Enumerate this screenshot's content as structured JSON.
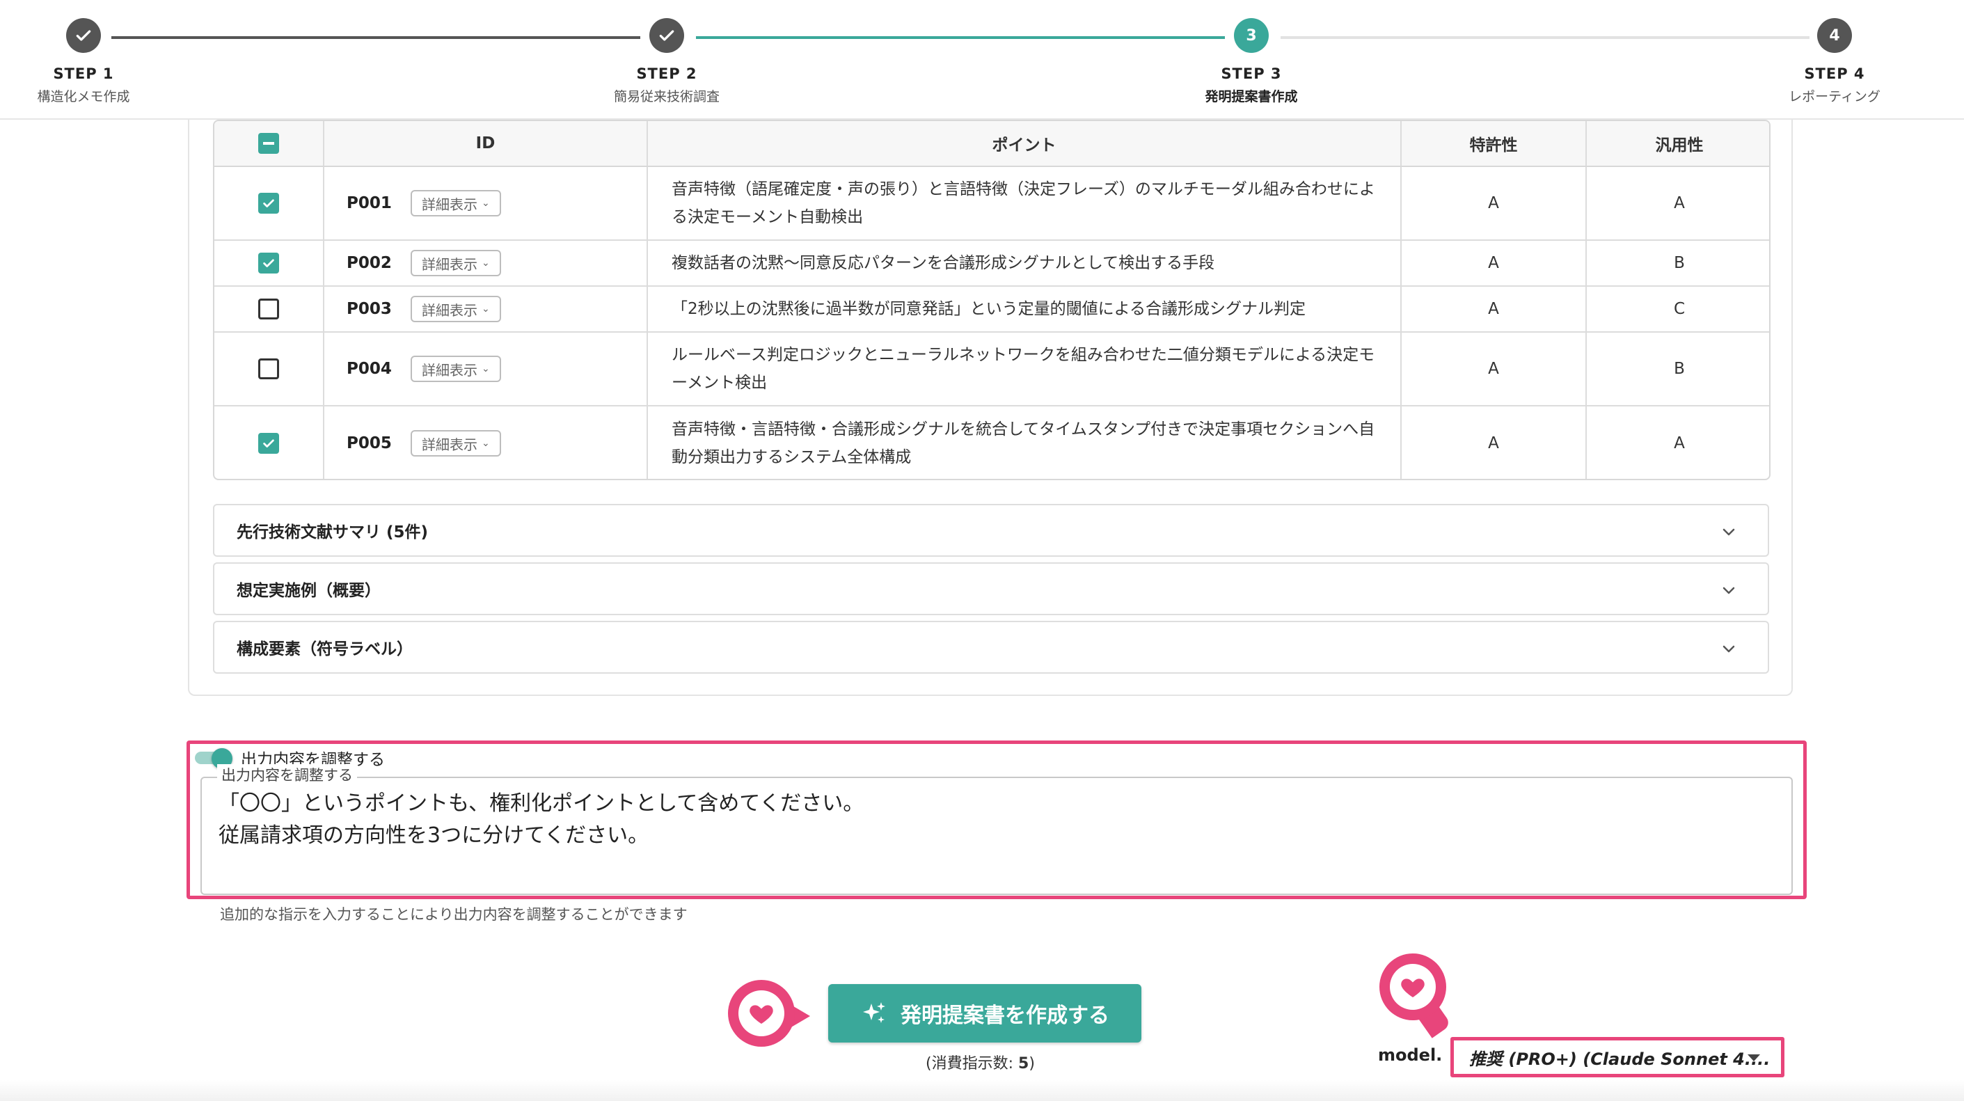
{
  "stepper": {
    "steps": [
      {
        "title": "STEP 1",
        "label": "構造化メモ作成",
        "state": "done"
      },
      {
        "title": "STEP 2",
        "label": "簡易従来技術調査",
        "state": "done"
      },
      {
        "title": "STEP 3",
        "label": "発明提案書作成",
        "state": "active",
        "number": "3"
      },
      {
        "title": "STEP 4",
        "label": "レポーティング",
        "state": "todo",
        "number": "4"
      }
    ]
  },
  "table": {
    "headers": {
      "id": "ID",
      "point": "ポイント",
      "patentability": "特許性",
      "generality": "汎用性"
    },
    "detail_label": "詳細表示",
    "rows": [
      {
        "id": "P001",
        "checked": true,
        "point": "音声特徴（語尾確定度・声の張り）と言語特徴（決定フレーズ）のマルチモーダル組み合わせによる決定モーメント自動検出",
        "patentability": "A",
        "generality": "A"
      },
      {
        "id": "P002",
        "checked": true,
        "point": "複数話者の沈黙〜同意反応パターンを合議形成シグナルとして検出する手段",
        "patentability": "A",
        "generality": "B"
      },
      {
        "id": "P003",
        "checked": false,
        "point": "「2秒以上の沈黙後に過半数が同意発話」という定量的閾値による合議形成シグナル判定",
        "patentability": "A",
        "generality": "C"
      },
      {
        "id": "P004",
        "checked": false,
        "point": "ルールベース判定ロジックとニューラルネットワークを組み合わせた二値分類モデルによる決定モーメント検出",
        "patentability": "A",
        "generality": "B"
      },
      {
        "id": "P005",
        "checked": true,
        "point": "音声特徴・言語特徴・合議形成シグナルを統合してタイムスタンプ付きで決定事項セクションへ自動分類出力するシステム全体構成",
        "patentability": "A",
        "generality": "A"
      }
    ]
  },
  "accordions": [
    {
      "label": "先行技術文献サマリ (5件)"
    },
    {
      "label": "想定実施例（概要）"
    },
    {
      "label": "構成要素（符号ラベル）"
    }
  ],
  "adjust": {
    "toggle_label": "出力内容を調整する",
    "field_label": "出力内容を調整する",
    "value_line1": "「〇〇」というポイントも、権利化ポイントとして含めてください。",
    "value_line2": "従属請求項の方向性を3つに分けてください。",
    "helper": "追加的な指示を入力することにより出力内容を調整することができます"
  },
  "actions": {
    "create_label": "発明提案書を作成する",
    "consume_prefix": "(消費指示数: ",
    "consume_count": "5",
    "consume_suffix": ")"
  },
  "model": {
    "label": "model.",
    "selected": "推奨 (PRO+) (Claude Sonnet 4...."
  },
  "colors": {
    "accent": "#3aa89a",
    "highlight": "#e8457b",
    "done": "#555555"
  }
}
